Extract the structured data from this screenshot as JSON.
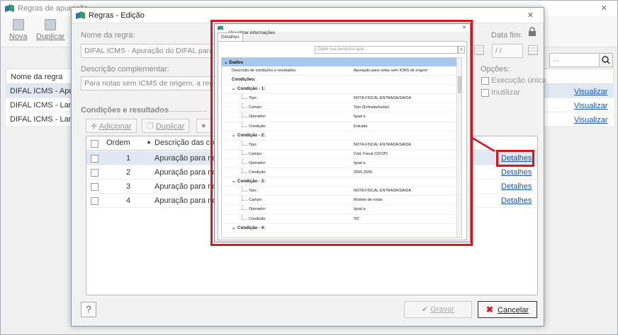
{
  "bg": {
    "title": "Regras de apuração",
    "toolbar": {
      "nova": "Nova",
      "duplicar": "Duplicar"
    },
    "search_placeholder": "...",
    "table_header": "Nome da regra",
    "rows": [
      "DIFAL ICMS - Apura",
      "DIFAL ICMS - Lança",
      "DIFAL ICMS - Lança"
    ],
    "links": [
      "Visualizar",
      "Visualizar",
      "Visualizar"
    ]
  },
  "dialog": {
    "title": "Regras - Edição",
    "nome_label": "Nome da regra:",
    "nome_value": "DIFAL ICMS - Apuração do DIFAL para nota",
    "data_fim_label": "Data fim:",
    "data_fim_value": "/ /",
    "descricao_label": "Descrição complementar:",
    "descricao_value": "Para notas sem ICMS de origem, a regra va",
    "opcoes_label": "Opções:",
    "opt_execucao": "Execução única",
    "opt_inutilizar": "Inutilizar",
    "secao_title": "Condições e resultados",
    "btn_adicionar": "Adicionar",
    "btn_duplicar": "Duplicar",
    "grid": {
      "col_ordem": "Ordem",
      "col_descricao": "Descrição das con",
      "rows": [
        {
          "ordem": "1",
          "descricao": "Apuração para not",
          "link": "Detalhes"
        },
        {
          "ordem": "2",
          "descricao": "Apuração para not",
          "link": "Detalhes"
        },
        {
          "ordem": "3",
          "descricao": "Apuração para not",
          "link": "Detalhes"
        },
        {
          "ordem": "4",
          "descricao": "Apuração para not",
          "link": "Detalhes"
        }
      ]
    },
    "help": "?",
    "btn_gravar": "Gravar",
    "btn_cancelar": "Cancelar"
  },
  "popup": {
    "title": "Visualizar informações",
    "tab": "Detalhes",
    "search_placeholder": "Digite sua pesquisa aqui...",
    "header": "Dados",
    "items": [
      {
        "k": "Descrição de condições e resultados:",
        "v": "Apuração para notas sem ICMS de origem",
        "lvl": 1
      },
      {
        "k": "Condições:",
        "v": "",
        "lvl": 1,
        "grp": true
      },
      {
        "k": "Condição - 1:",
        "v": "",
        "lvl": 2,
        "grp": true
      },
      {
        "k": "Tipo:",
        "v": "NOTA FISCAL ENTRADA/SAIDA",
        "lvl": 3
      },
      {
        "k": "Campo:",
        "v": "Tipo (Entrada/saída)",
        "lvl": 3
      },
      {
        "k": "Operador:",
        "v": "Igual a",
        "lvl": 3
      },
      {
        "k": "Condição:",
        "v": "Entrada",
        "lvl": 3
      },
      {
        "k": "Condição - 2:",
        "v": "",
        "lvl": 2,
        "grp": true
      },
      {
        "k": "Tipo:",
        "v": "NOTA FISCAL ENTRADA/SAIDA",
        "lvl": 3
      },
      {
        "k": "Campo:",
        "v": "Cód. Fiscal (CFOP)",
        "lvl": 3
      },
      {
        "k": "Operador:",
        "v": "Igual a",
        "lvl": 3
      },
      {
        "k": "Condição:",
        "v": "2555,2556",
        "lvl": 3
      },
      {
        "k": "Condição - 3:",
        "v": "",
        "lvl": 2,
        "grp": true
      },
      {
        "k": "Tipo:",
        "v": "NOTA FISCAL ENTRADA/SAIDA",
        "lvl": 3
      },
      {
        "k": "Campo:",
        "v": "Modelo de notas",
        "lvl": 3
      },
      {
        "k": "Operador:",
        "v": "Igual a",
        "lvl": 3
      },
      {
        "k": "Condição:",
        "v": "'55'",
        "lvl": 3
      },
      {
        "k": "Condição - 4:",
        "v": "",
        "lvl": 2,
        "grp": true
      }
    ]
  },
  "colors": {
    "highlight": "#e0121b",
    "link": "#1a55b4",
    "tree_header": "#a6c8ec"
  }
}
